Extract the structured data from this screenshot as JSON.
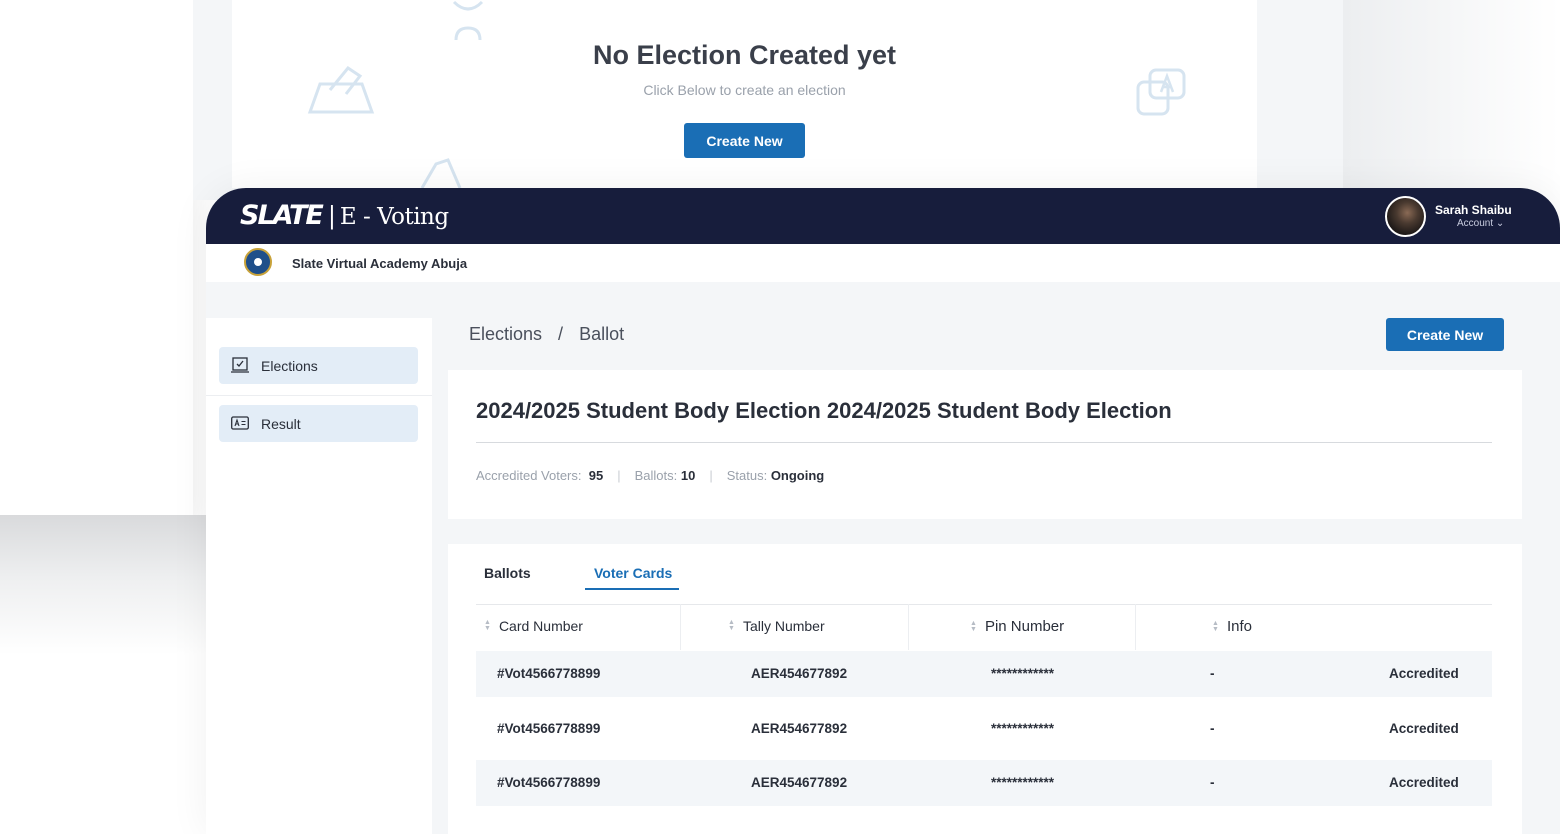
{
  "background": {
    "empty_state": {
      "title": "No Election Created yet",
      "subtitle": "Click Below to create an election",
      "button": "Create New"
    }
  },
  "app": {
    "brand": "SLATE",
    "brand_separator": "|",
    "product": "E - Voting",
    "user": {
      "name": "Sarah Shaibu",
      "account": "Account ⌄"
    },
    "school": {
      "name": "Slate Virtual Academy Abuja"
    },
    "sidebar": {
      "items": [
        {
          "label": "Elections",
          "icon": "ballot-box-icon"
        },
        {
          "label": "Result",
          "icon": "id-card-icon"
        }
      ]
    },
    "breadcrumb": {
      "parent": "Elections",
      "separator": "/",
      "current": "Ballot"
    },
    "header_button": "Create New",
    "election": {
      "title": "2024/2025 Student Body Election 2024/2025 Student Body Election",
      "stats": {
        "accredited_label": "Accredited Voters:",
        "accredited_value": "95",
        "ballots_label": "Ballots:",
        "ballots_value": "10",
        "status_label": "Status:",
        "status_value": "Ongoing"
      }
    },
    "tabs": [
      {
        "label": "Ballots",
        "active": false
      },
      {
        "label": "Voter Cards",
        "active": true
      }
    ],
    "table": {
      "columns": [
        "Card Number",
        "Tally Number",
        "Pin Number",
        "Info"
      ],
      "rows": [
        {
          "card": "#Vot4566778899",
          "tally": "AER454677892",
          "pin": "************",
          "info": "-",
          "status": "Accredited"
        },
        {
          "card": "#Vot4566778899",
          "tally": "AER454677892",
          "pin": "************",
          "info": "-",
          "status": "Accredited"
        },
        {
          "card": "#Vot4566778899",
          "tally": "AER454677892",
          "pin": "************",
          "info": "-",
          "status": "Accredited"
        }
      ]
    },
    "colors": {
      "navy": "#171d3c",
      "primary": "#1a6eb5",
      "sidebar_active": "#e3edf7",
      "page_bg": "#f4f6f8"
    }
  }
}
